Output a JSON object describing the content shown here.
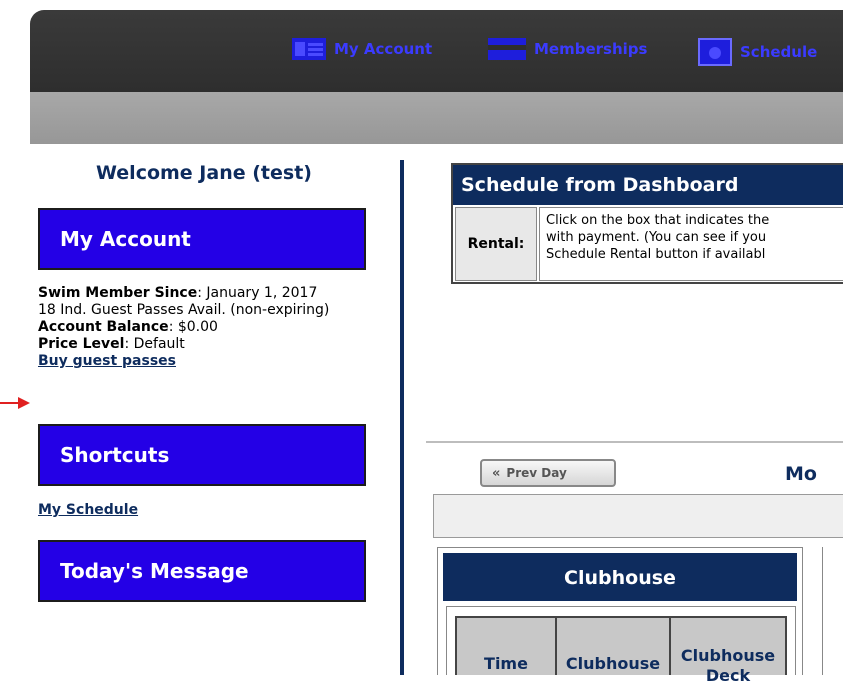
{
  "nav": {
    "items": [
      {
        "label": "My Account",
        "icon": "account-card-icon"
      },
      {
        "label": "Memberships",
        "icon": "membership-card-icon"
      },
      {
        "label": "Schedule",
        "icon": "calendar-icon"
      }
    ]
  },
  "sidebar": {
    "welcome": "Welcome Jane (test)",
    "my_account_title": "My Account",
    "member_since_label": "Swim Member Since",
    "member_since_value": ": January 1, 2017",
    "guest_passes": "18 Ind. Guest Passes Avail. (non-expiring)",
    "balance_label": "Account Balance",
    "balance_value": ": $0.00",
    "price_level_label": "Price Level",
    "price_level_value": ": Default",
    "buy_link": "Buy guest passes",
    "shortcuts_title": "Shortcuts",
    "my_schedule_link": "My Schedule",
    "todays_message_title": "Today's Message"
  },
  "schedule": {
    "title": "Schedule from Dashboard",
    "rental_label": "Rental:",
    "rental_lines": [
      "Click on the box that indicates the",
      "with payment. (You can see if you",
      "Schedule Rental button if availabl"
    ]
  },
  "calendar": {
    "prev_label": "Prev Day",
    "day_title": "Mo",
    "section_title": "Clubhouse",
    "columns": [
      "Time",
      "Clubhouse",
      "Clubhouse Deck"
    ]
  },
  "colors": {
    "nav_text": "#3b3bff",
    "panel_blue": "#2400e6",
    "navy": "#0e2c5e",
    "arrow_red": "#e02020"
  }
}
